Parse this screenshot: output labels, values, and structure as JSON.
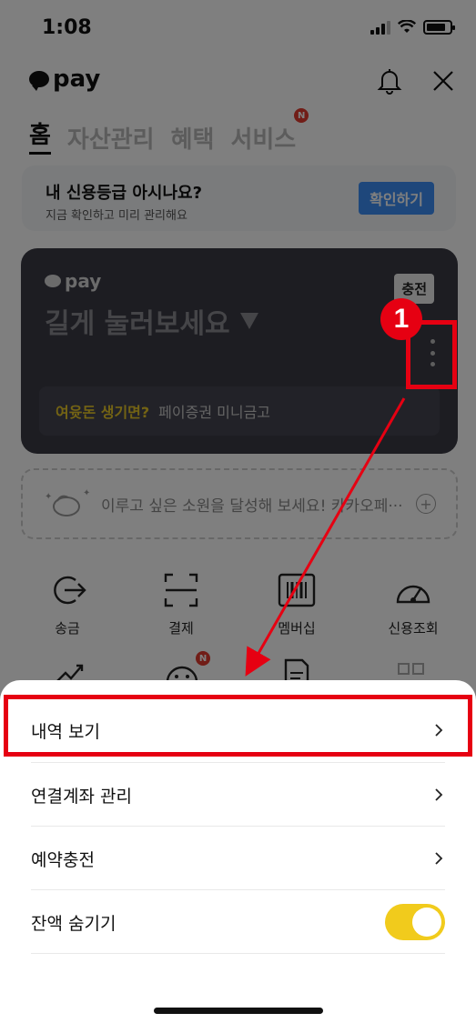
{
  "status_bar": {
    "time": "1:08"
  },
  "header": {
    "brand": "pay"
  },
  "tabs": [
    {
      "label": "홈",
      "active": true
    },
    {
      "label": "자산관리"
    },
    {
      "label": "혜택"
    },
    {
      "label": "서비스",
      "badge": "N"
    }
  ],
  "credit_banner": {
    "title": "내 신용등급 아시나요?",
    "subtitle": "지금 확인하고 미리 관리해요",
    "button": "확인하기"
  },
  "pay_card": {
    "logo": "pay",
    "hint": "길게 눌러보세요",
    "charge_button": "충전",
    "promo_highlight": "여윳돈 생기면?",
    "promo_text": "페이증권 미니금고"
  },
  "wish_banner": {
    "text": "이루고 싶은 소원을 달성해 보세요! 카카오페···"
  },
  "quick_menu": [
    {
      "label": "송금",
      "icon": "send-icon"
    },
    {
      "label": "결제",
      "icon": "scan-icon"
    },
    {
      "label": "멤버십",
      "icon": "barcode-icon"
    },
    {
      "label": "신용조회",
      "icon": "gauge-icon"
    }
  ],
  "quick_menu_row2_badge": "N",
  "sheet": {
    "items": [
      {
        "label": "내역 보기"
      },
      {
        "label": "연결계좌 관리"
      },
      {
        "label": "예약충전"
      },
      {
        "label": "잔액 숨기기"
      }
    ],
    "hide_balance_on": true
  },
  "annotation": {
    "step_number": "1",
    "color": "#e60012"
  }
}
